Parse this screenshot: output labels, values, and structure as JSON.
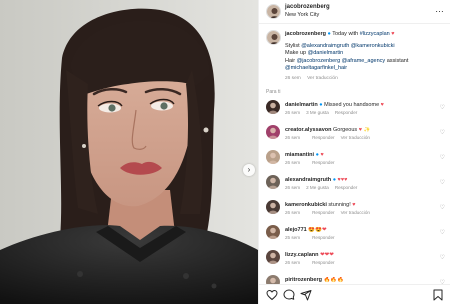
{
  "post": {
    "username": "jacobrozenberg",
    "location": "New York City",
    "more_icon": "…",
    "next_icon": "›"
  },
  "caption": {
    "username": "jacobrozenberg",
    "text": "Today with",
    "mention": "#lizzycaplan",
    "credits": [
      {
        "label": "Stylist",
        "handles": "@alexandraimgruth @kameronkubicki"
      },
      {
        "label": "Make up",
        "handles": "@danielmartin"
      },
      {
        "label": "Hair",
        "handles": "@jacobrozenberg @aframe_agency",
        "suffix": "assistant"
      },
      {
        "label": "",
        "handles": "@michaeltagarfinkel_hair"
      }
    ],
    "time": "26 sem",
    "translate": "Ver traducción"
  },
  "section_label": "Para ti",
  "comments": [
    {
      "user": "danielmartin",
      "verified": true,
      "text": "Missed you handsome",
      "emoji": "♥",
      "time": "26 sem",
      "likes": "3 Me gusta",
      "reply": "Responder",
      "translate": "",
      "avatar_color": "#3a2a26"
    },
    {
      "user": "creator.alyssavon",
      "verified": false,
      "text": "Gorgeous",
      "emoji": "♥ ✨",
      "time": "26 sem",
      "likes": "",
      "reply": "Responder",
      "translate": "Ver traducción",
      "avatar_color": "#a0406a"
    },
    {
      "user": "miamantini",
      "verified": true,
      "text": "",
      "emoji": "♥",
      "time": "26 sem",
      "likes": "",
      "reply": "Responder",
      "translate": "",
      "avatar_color": "#b9a08a"
    },
    {
      "user": "alexandraimgruth",
      "verified": true,
      "text": "",
      "emoji": "♥♥♥",
      "time": "26 sem",
      "likes": "2 Me gusta",
      "reply": "Responder",
      "translate": "",
      "avatar_color": "#6d6258"
    },
    {
      "user": "kameronkubicki",
      "verified": false,
      "text": "stunning!",
      "emoji": "♥",
      "time": "26 sem",
      "likes": "",
      "reply": "Responder",
      "translate": "Ver traducción",
      "avatar_color": "#4a3a35"
    },
    {
      "user": "alejo771",
      "verified": false,
      "text": "",
      "emoji": "😍😍❤",
      "time": "25 sem",
      "likes": "",
      "reply": "Responder",
      "translate": "",
      "avatar_color": "#7a5d4a"
    },
    {
      "user": "lizzy.caplann",
      "verified": false,
      "text": "",
      "emoji": "❤❤❤",
      "time": "26 sem",
      "likes": "",
      "reply": "Responder",
      "translate": "",
      "avatar_color": "#5b463f"
    },
    {
      "user": "piritrozenberg",
      "verified": false,
      "text": "",
      "emoji": "🔥🔥🔥",
      "time": "",
      "likes": "",
      "reply": "",
      "translate": "",
      "avatar_color": "#8c7b6e"
    }
  ],
  "colors": {
    "link": "#00376b",
    "heart": "#ed4956",
    "verified": "#0095f6",
    "muted": "#8e8e8e"
  },
  "icons": [
    "heart-icon",
    "comment-icon",
    "share-icon",
    "bookmark-icon"
  ]
}
